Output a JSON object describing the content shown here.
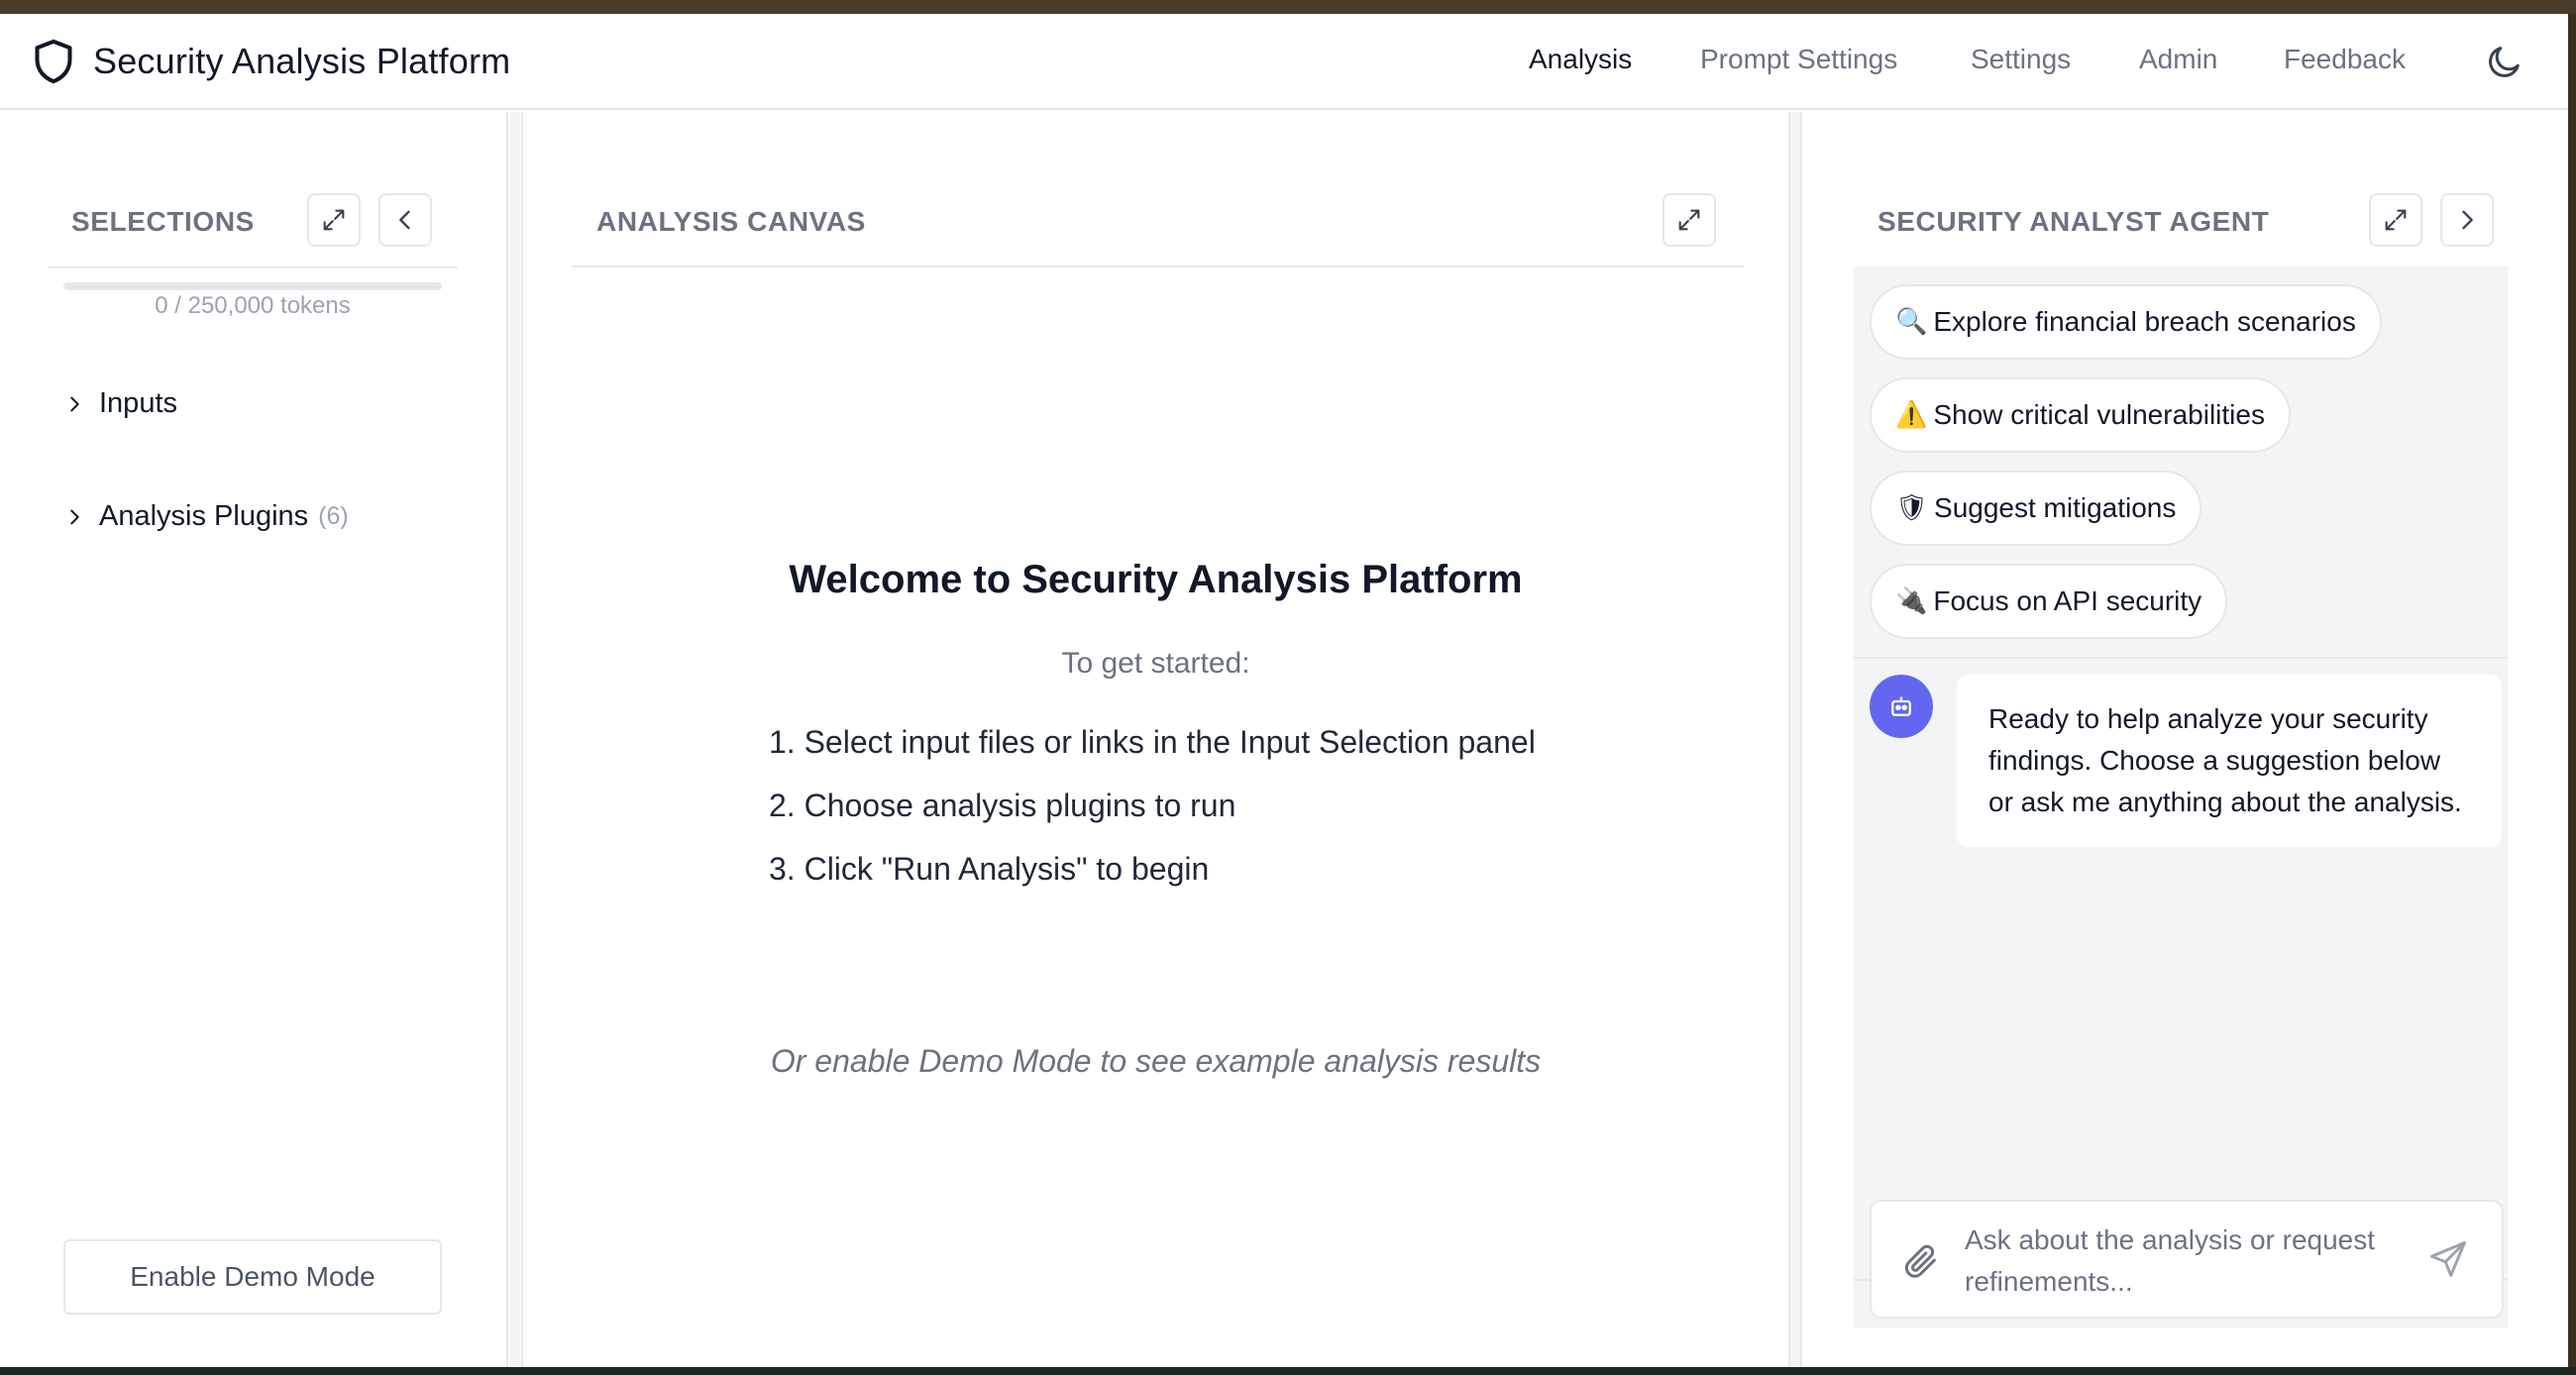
{
  "app": {
    "title": "Security Analysis Platform"
  },
  "nav": {
    "items": [
      {
        "label": "Analysis",
        "active": true
      },
      {
        "label": "Prompt Settings",
        "active": false
      },
      {
        "label": "Settings",
        "active": false
      },
      {
        "label": "Admin",
        "active": false
      },
      {
        "label": "Feedback",
        "active": false
      }
    ],
    "theme_icon": "moon-icon"
  },
  "selections": {
    "title": "SELECTIONS",
    "token_usage": 0,
    "token_text": "0 / 250,000 tokens",
    "tree": [
      {
        "label": "Inputs",
        "count": ""
      },
      {
        "label": "Analysis Plugins",
        "count": "(6)"
      }
    ],
    "demo_button": "Enable Demo Mode"
  },
  "canvas": {
    "title": "ANALYSIS CANVAS",
    "welcome_title": "Welcome to Security Analysis Platform",
    "subtitle": "To get started:",
    "steps": [
      "1. Select input files or links in the Input Selection panel",
      "2. Choose analysis plugins to run",
      "3. Click \"Run Analysis\" to begin"
    ],
    "demo_hint": "Or enable Demo Mode to see example analysis results"
  },
  "agent": {
    "title": "SECURITY ANALYST AGENT",
    "suggestions": [
      {
        "emoji": "🔍",
        "label": "Explore financial breach scenarios"
      },
      {
        "emoji": "⚠️",
        "label": "Show critical vulnerabilities"
      },
      {
        "emoji": "🛡",
        "label": "Suggest mitigations"
      },
      {
        "emoji": "🔌",
        "label": "Focus on API security"
      }
    ],
    "message": "Ready to help analyze your security findings. Choose a suggestion below or ask me anything about the analysis.",
    "input_placeholder": "Ask about the analysis or request refinements..."
  },
  "colors": {
    "accent": "#6366f1",
    "border": "#e5e7eb",
    "muted": "#6b7280"
  }
}
